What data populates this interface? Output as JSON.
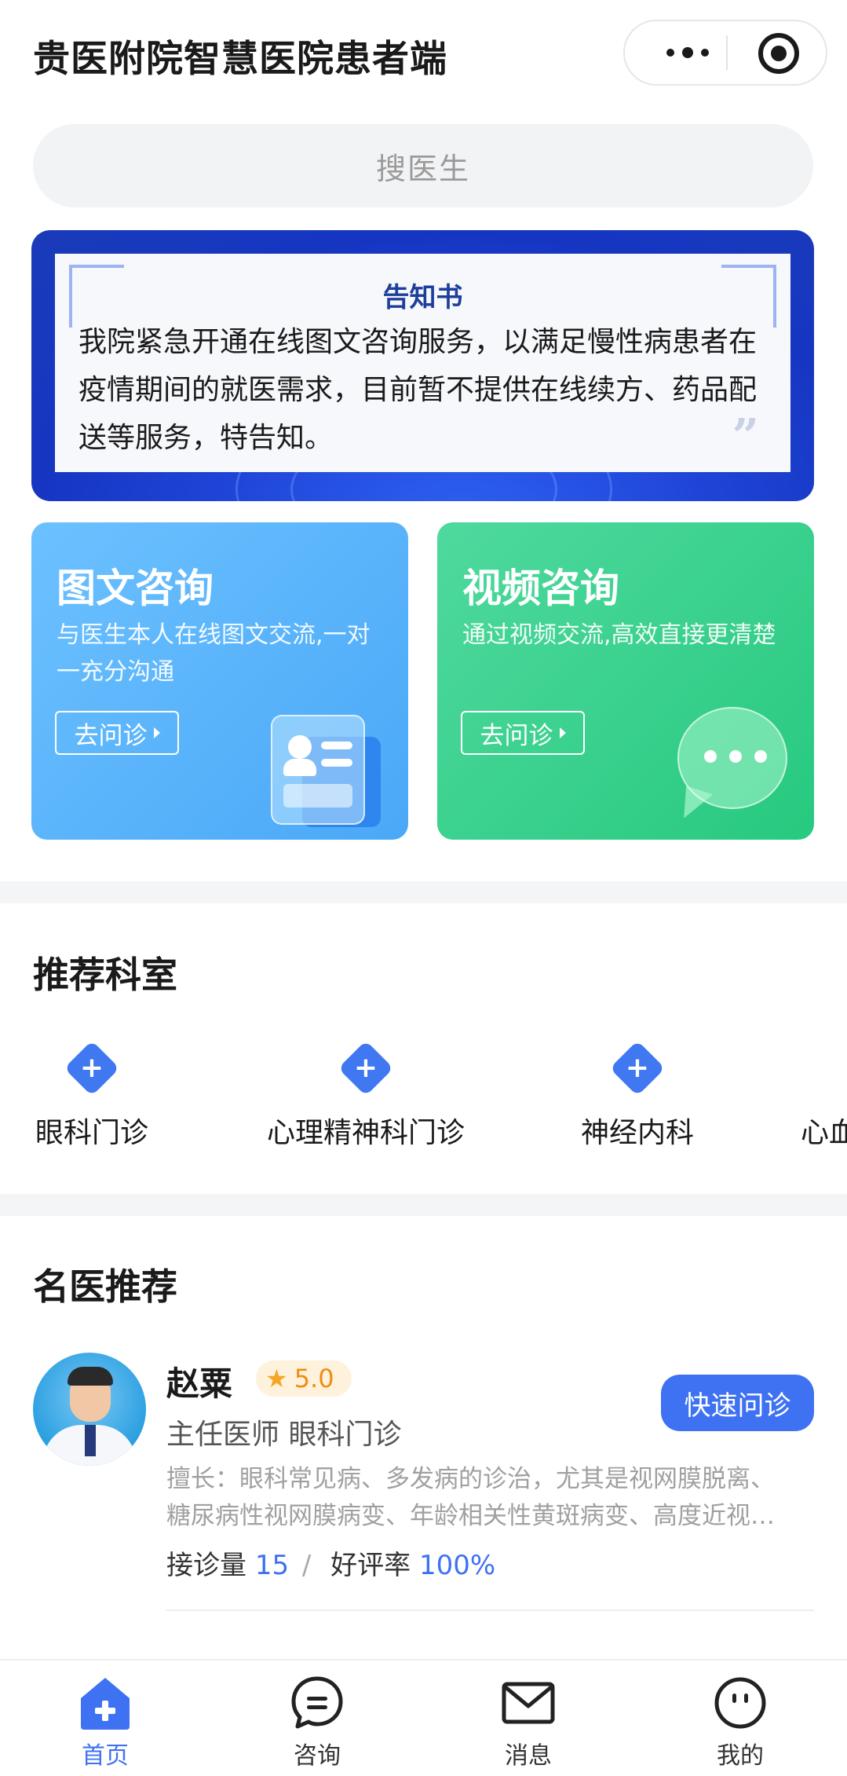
{
  "header": {
    "title": "贵医附院智慧医院患者端"
  },
  "search": {
    "placeholder": "搜医生"
  },
  "notice": {
    "title": "告知书",
    "text": "我院紧急开通在线图文咨询服务，以满足慢性病患者在疫情期间的就医需求，目前暂不提供在线续方、药品配送等服务，特告知。",
    "quote_mark": "”"
  },
  "consult": {
    "text_card": {
      "title": "图文咨询",
      "desc": "与医生本人在线图文交流,一对一充分沟通",
      "button": "去问诊"
    },
    "video_card": {
      "title": "视频咨询",
      "desc": "通过视频交流,高效直接更清楚",
      "button": "去问诊"
    }
  },
  "departments": {
    "title": "推荐科室",
    "items": [
      "眼科门诊",
      "心理精神科门诊",
      "神经内科",
      "心血"
    ]
  },
  "doctors": {
    "title": "名医推荐",
    "items": [
      {
        "name": "赵粟",
        "rating": "5.0",
        "title": "主任医师 眼科门诊",
        "skill_line1": "擅长：眼科常见病、多发病的诊治，尤其是视网膜脱离、",
        "skill_line2": "糖尿病性视网膜病变、年龄相关性黄斑病变、高度近视…",
        "consult_label": "接诊量",
        "consult_count": "15",
        "separator": "/",
        "praise_label": "好评率",
        "praise_rate": "100%",
        "button": "快速问诊"
      }
    ]
  },
  "tabbar": {
    "items": [
      {
        "label": "首页",
        "icon": "home-plus-icon",
        "active": true
      },
      {
        "label": "咨询",
        "icon": "chat-icon",
        "active": false
      },
      {
        "label": "消息",
        "icon": "mail-icon",
        "active": false
      },
      {
        "label": "我的",
        "icon": "smiley-user-icon",
        "active": false
      }
    ]
  },
  "colors": {
    "accent": "#3f72f2",
    "blue_card": "#4aa8f7",
    "green_card": "#27c97f",
    "rating": "#f08d13"
  }
}
